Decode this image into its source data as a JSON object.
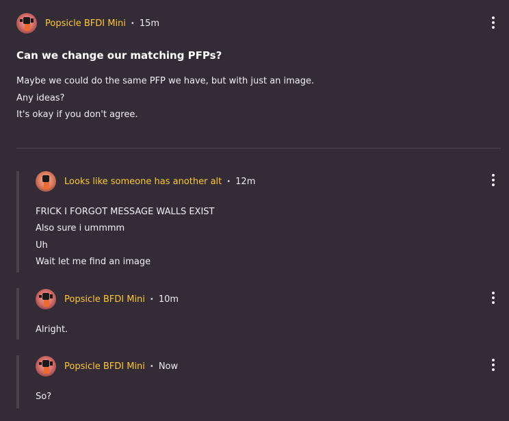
{
  "post": {
    "author": "Popsicle BFDI Mini",
    "time": "15m",
    "title": "Can we change our matching PFPs?",
    "body": [
      "Maybe we could do the same PFP we have, but with just an image.",
      "Any ideas?",
      "It's okay if you don't agree."
    ]
  },
  "replies": [
    {
      "author": "Looks like someone has another alt",
      "time": "12m",
      "body": [
        "FRICK I FORGOT MESSAGE WALLS EXIST",
        "Also sure i ummmm",
        "Uh",
        "Wait let me find an image"
      ]
    },
    {
      "author": "Popsicle BFDI Mini",
      "time": "10m",
      "body": [
        "Alright."
      ]
    },
    {
      "author": "Popsicle BFDI Mini",
      "time": "Now",
      "body": [
        "So?"
      ]
    }
  ],
  "separator": "•",
  "icons": {
    "menu": "more-vertical-icon",
    "avatar": "user-avatar"
  },
  "colors": {
    "background": "#332c36",
    "username": "#ffc82f",
    "text": "#f4eff6",
    "divider": "#4c4550",
    "reply_bar": "#494249"
  }
}
